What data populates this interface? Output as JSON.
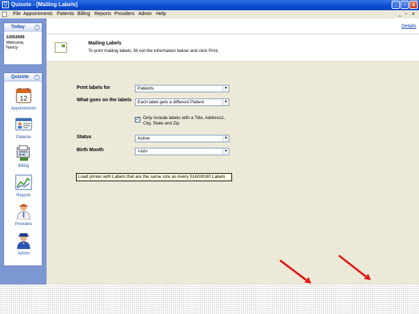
{
  "window": {
    "title": "Quixote - [Mailing Labels]",
    "app_icon": "Q",
    "minimize_glyph": "_",
    "restore_glyph": "▫",
    "close_glyph": "x"
  },
  "menu": {
    "items": [
      "File",
      "Appointments",
      "Patients",
      "Billing",
      "Reports",
      "Providers",
      "Admin",
      "Help"
    ],
    "mdi_minimize": "_",
    "mdi_restore": "▫",
    "mdi_close": "x"
  },
  "today_panel": {
    "title": "Today",
    "collapse_glyph": "^",
    "date": "1/20/2009",
    "welcome": "Welcome,",
    "user": "Nancy"
  },
  "nav_panel": {
    "title": "Quixote",
    "collapse_glyph": "^",
    "items": [
      {
        "label": "Appointments",
        "icon": "calendar-icon"
      },
      {
        "label": "Patients",
        "icon": "patient-card-icon"
      },
      {
        "label": "Billing",
        "icon": "billing-icon"
      },
      {
        "label": "Reports",
        "icon": "reports-chart-icon"
      },
      {
        "label": "Providers",
        "icon": "provider-icon"
      },
      {
        "label": "Admin",
        "icon": "admin-icon"
      }
    ],
    "calendar_number": "12"
  },
  "details_link": "Details",
  "header": {
    "title": "Mailing Labels",
    "subtitle": "To print mailing labels, fill out the information below and click Print."
  },
  "form": {
    "print_labels_for": {
      "label": "Print labels for",
      "value": "Patients"
    },
    "what_goes": {
      "label": "What goes on the labels",
      "value": "Each label gets a different Patient"
    },
    "only_include": {
      "label": "Only include labels with a Title, Address1, City, State and Zip",
      "checked": true,
      "glyph": "✓"
    },
    "status": {
      "label": "Status",
      "value": "Active"
    },
    "birth_month": {
      "label": "Birth Month",
      "value": "<All>"
    },
    "dropdown_glyph": "▼"
  },
  "notice": "Load printer with Labels that are the same size as Avery 5160/8160 Labels",
  "colors": {
    "titlebar": "#0b4bd0",
    "sidebar": "#7d97d3",
    "content": "#ece9d8",
    "notice_bg": "#ffffe1",
    "annotation_arrow": "#e01b16"
  }
}
